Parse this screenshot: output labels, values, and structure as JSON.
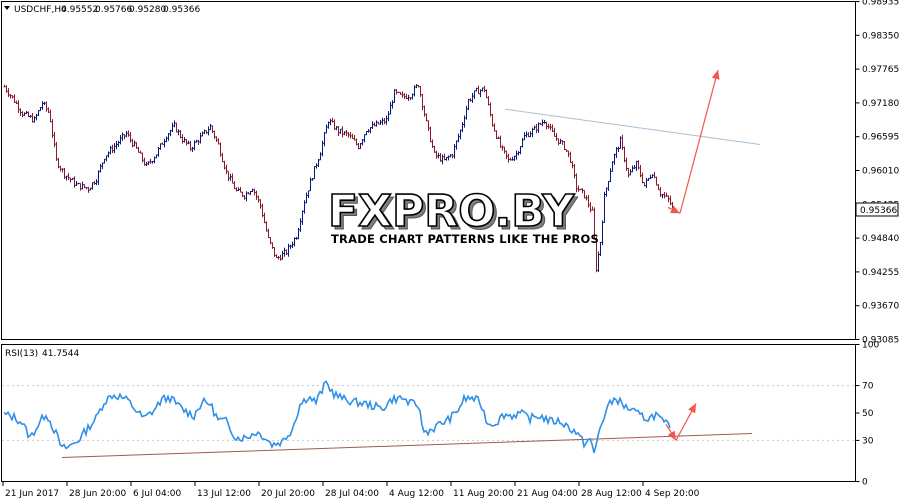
{
  "header": {
    "symbol": "USDCHF,H4",
    "open": "0.95552",
    "high": "0.95766",
    "low": "0.95280",
    "close": "0.95366"
  },
  "watermark": {
    "brand": "FXPRO.BY",
    "tagline": "TRADE CHART PATTERNS LIKE THE PROS"
  },
  "current_price_label": "0.95366",
  "rsi_header": {
    "label": "RSI(13)",
    "value": "41.7544"
  },
  "colors": {
    "bull_bar": "#0a1a7a",
    "bear_bar": "#8b1a2a",
    "rsi_line": "#2f8fe6",
    "resistance_line": "#a9c0d4",
    "support_line": "#a05a50",
    "forecast_arrow": "#f0564b",
    "frame": "#000000"
  },
  "chart_data": [
    {
      "type": "ohlc",
      "title": "USDCHF,H4",
      "x_ticks": [
        "21 Jun 2017",
        "28 Jun 20:00",
        "6 Jul 04:00",
        "13 Jul 12:00",
        "20 Jul 20:00",
        "28 Jul 04:00",
        "4 Aug 12:00",
        "11 Aug 20:00",
        "21 Aug 04:00",
        "28 Aug 12:00",
        "4 Sep 20:00"
      ],
      "y_ticks": [
        "0.98935",
        "0.98350",
        "0.97765",
        "0.97180",
        "0.96595",
        "0.96010",
        "0.95425",
        "0.94840",
        "0.94255",
        "0.93670",
        "0.93085"
      ],
      "ylim": [
        0.93085,
        0.98935
      ],
      "path_points": [
        [
          0,
          0.9746
        ],
        [
          10,
          0.9722
        ],
        [
          18,
          0.97
        ],
        [
          30,
          0.9688
        ],
        [
          38,
          0.9718
        ],
        [
          45,
          0.97
        ],
        [
          52,
          0.9618
        ],
        [
          60,
          0.9595
        ],
        [
          72,
          0.9576
        ],
        [
          84,
          0.957
        ],
        [
          92,
          0.9587
        ],
        [
          100,
          0.9625
        ],
        [
          110,
          0.9643
        ],
        [
          122,
          0.9665
        ],
        [
          132,
          0.9638
        ],
        [
          142,
          0.9608
        ],
        [
          152,
          0.963
        ],
        [
          162,
          0.9662
        ],
        [
          170,
          0.9678
        ],
        [
          178,
          0.9655
        ],
        [
          186,
          0.964
        ],
        [
          196,
          0.9658
        ],
        [
          206,
          0.9677
        ],
        [
          214,
          0.9645
        ],
        [
          222,
          0.9598
        ],
        [
          232,
          0.9565
        ],
        [
          240,
          0.9558
        ],
        [
          248,
          0.9572
        ],
        [
          256,
          0.954
        ],
        [
          264,
          0.9482
        ],
        [
          272,
          0.9448
        ],
        [
          282,
          0.946
        ],
        [
          292,
          0.9488
        ],
        [
          300,
          0.9548
        ],
        [
          308,
          0.9592
        ],
        [
          316,
          0.9634
        ],
        [
          324,
          0.9688
        ],
        [
          334,
          0.9669
        ],
        [
          344,
          0.9662
        ],
        [
          354,
          0.9643
        ],
        [
          362,
          0.9672
        ],
        [
          372,
          0.968
        ],
        [
          382,
          0.9688
        ],
        [
          390,
          0.9735
        ],
        [
          398,
          0.9728
        ],
        [
          406,
          0.9732
        ],
        [
          414,
          0.975
        ],
        [
          422,
          0.9683
        ],
        [
          430,
          0.9628
        ],
        [
          440,
          0.9618
        ],
        [
          448,
          0.963
        ],
        [
          456,
          0.967
        ],
        [
          464,
          0.9722
        ],
        [
          472,
          0.9738
        ],
        [
          480,
          0.9742
        ],
        [
          488,
          0.9682
        ],
        [
          496,
          0.9642
        ],
        [
          504,
          0.9618
        ],
        [
          512,
          0.963
        ],
        [
          520,
          0.966
        ],
        [
          530,
          0.9672
        ],
        [
          540,
          0.9688
        ],
        [
          550,
          0.966
        ],
        [
          560,
          0.9642
        ],
        [
          566,
          0.962
        ],
        [
          572,
          0.9572
        ],
        [
          580,
          0.9558
        ],
        [
          588,
          0.9528
        ],
        [
          592,
          0.9432
        ],
        [
          596,
          0.9478
        ],
        [
          600,
          0.9555
        ],
        [
          608,
          0.9618
        ],
        [
          616,
          0.9652
        ],
        [
          624,
          0.9592
        ],
        [
          632,
          0.9612
        ],
        [
          640,
          0.9575
        ],
        [
          648,
          0.9598
        ],
        [
          656,
          0.9562
        ],
        [
          664,
          0.955
        ],
        [
          668,
          0.9537
        ]
      ],
      "resistance_line": [
        [
          505,
          0.9707
        ],
        [
          760,
          0.9646
        ]
      ],
      "forecast_arrows": [
        {
          "from": [
            668,
            0.9537
          ],
          "to": [
            680,
            0.9527
          ]
        },
        {
          "from": [
            680,
            0.9527
          ],
          "to": [
            718,
            0.9775
          ]
        }
      ],
      "current_price": 0.95366
    },
    {
      "type": "line",
      "title": "RSI(13) 41.7544",
      "y_ticks": [
        "100",
        "70",
        "50",
        "30",
        "0"
      ],
      "ylim": [
        0,
        100
      ],
      "path_points": [
        [
          0,
          49
        ],
        [
          10,
          47
        ],
        [
          18,
          43
        ],
        [
          26,
          32
        ],
        [
          34,
          41
        ],
        [
          42,
          50
        ],
        [
          52,
          35
        ],
        [
          58,
          24
        ],
        [
          64,
          25
        ],
        [
          74,
          30
        ],
        [
          84,
          39
        ],
        [
          92,
          46
        ],
        [
          100,
          58
        ],
        [
          108,
          63
        ],
        [
          116,
          62
        ],
        [
          124,
          59
        ],
        [
          132,
          52
        ],
        [
          140,
          46
        ],
        [
          150,
          52
        ],
        [
          158,
          60
        ],
        [
          166,
          61
        ],
        [
          172,
          57
        ],
        [
          180,
          52
        ],
        [
          190,
          48
        ],
        [
          198,
          58
        ],
        [
          206,
          57
        ],
        [
          214,
          45
        ],
        [
          222,
          44
        ],
        [
          232,
          32
        ],
        [
          242,
          32
        ],
        [
          252,
          36
        ],
        [
          260,
          33
        ],
        [
          268,
          27
        ],
        [
          278,
          29
        ],
        [
          288,
          38
        ],
        [
          296,
          56
        ],
        [
          304,
          62
        ],
        [
          312,
          58
        ],
        [
          322,
          72
        ],
        [
          330,
          64
        ],
        [
          340,
          60
        ],
        [
          350,
          58
        ],
        [
          360,
          57
        ],
        [
          370,
          55
        ],
        [
          378,
          53
        ],
        [
          388,
          60
        ],
        [
          398,
          61
        ],
        [
          406,
          57
        ],
        [
          414,
          56
        ],
        [
          420,
          36
        ],
        [
          428,
          38
        ],
        [
          436,
          42
        ],
        [
          444,
          45
        ],
        [
          452,
          50
        ],
        [
          460,
          60
        ],
        [
          468,
          61
        ],
        [
          476,
          58
        ],
        [
          484,
          42
        ],
        [
          492,
          43
        ],
        [
          500,
          49
        ],
        [
          508,
          48
        ],
        [
          516,
          50
        ],
        [
          526,
          46
        ],
        [
          536,
          48
        ],
        [
          546,
          44
        ],
        [
          556,
          44
        ],
        [
          564,
          40
        ],
        [
          572,
          36
        ],
        [
          580,
          28
        ],
        [
          586,
          31
        ],
        [
          590,
          20
        ],
        [
          596,
          39
        ],
        [
          604,
          55
        ],
        [
          612,
          61
        ],
        [
          620,
          55
        ],
        [
          628,
          52
        ],
        [
          636,
          48
        ],
        [
          644,
          46
        ],
        [
          652,
          49
        ],
        [
          660,
          42
        ],
        [
          666,
          41.75
        ]
      ],
      "support_line": [
        [
          62,
          17.5
        ],
        [
          752,
          35
        ]
      ],
      "forecast_arrows": [
        {
          "from": [
            666,
            41.75
          ],
          "to": [
            676,
            30
          ]
        },
        {
          "from": [
            676,
            30
          ],
          "to": [
            696,
            57
          ]
        }
      ]
    }
  ]
}
